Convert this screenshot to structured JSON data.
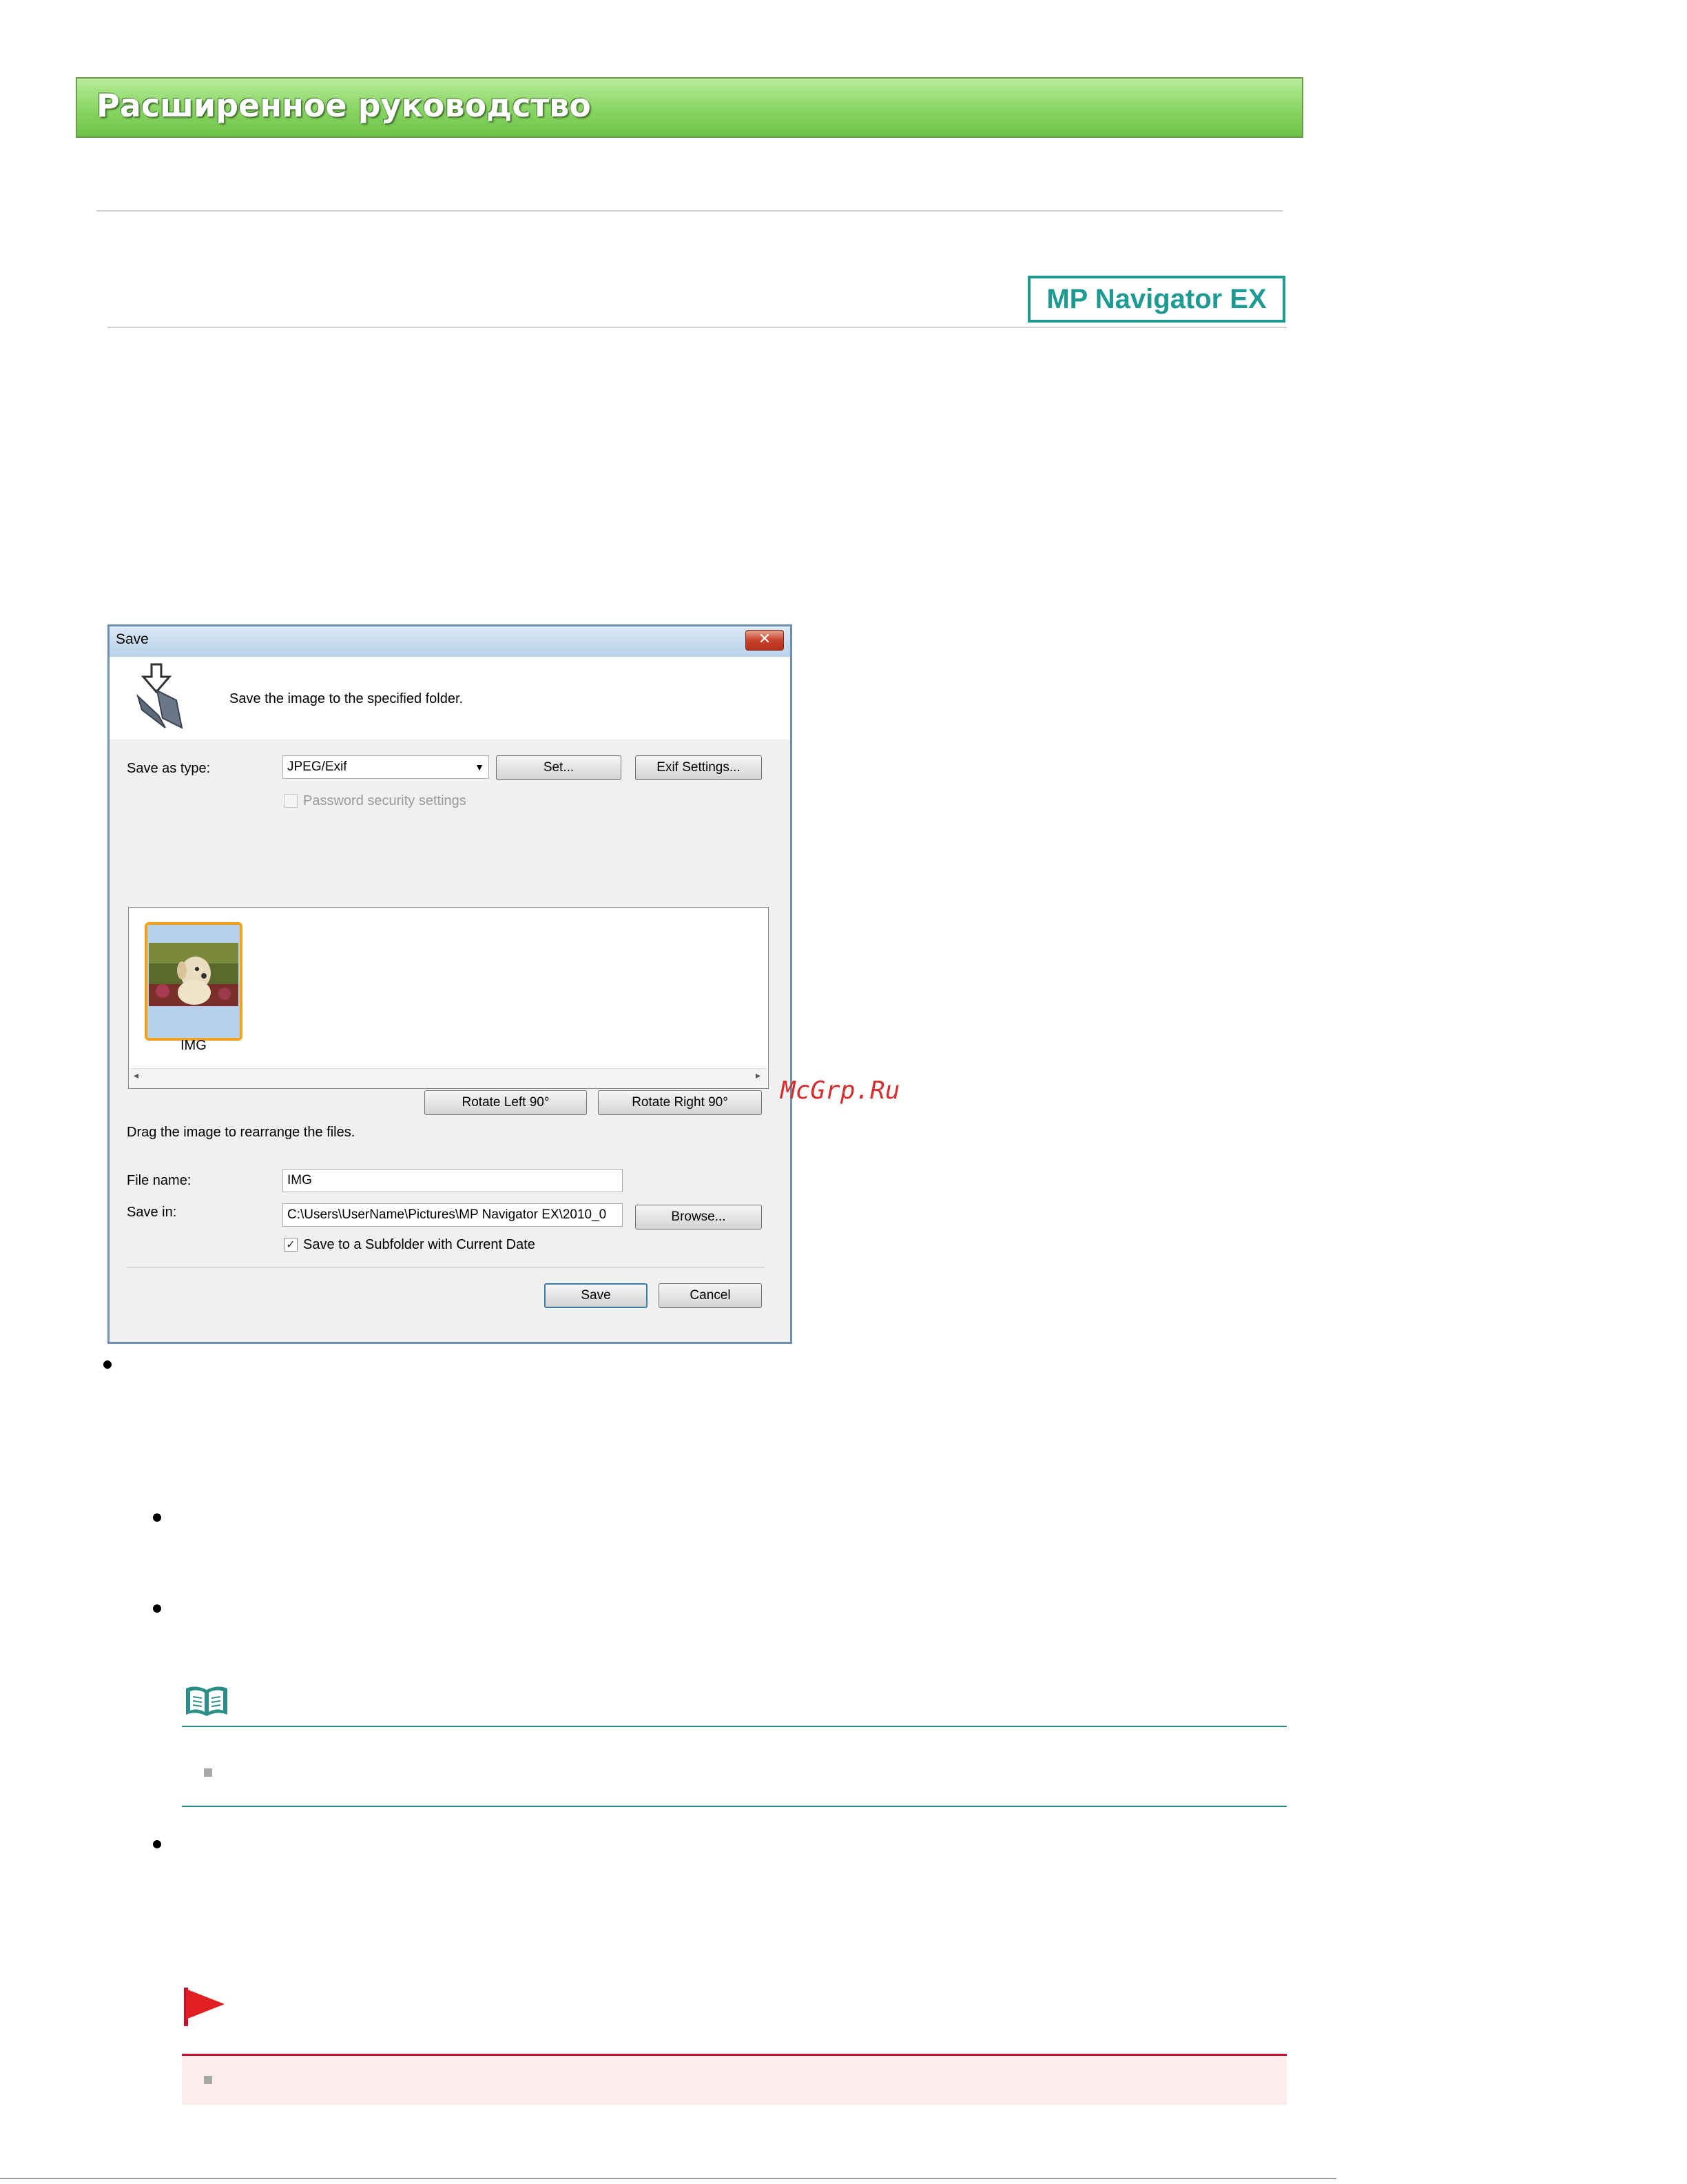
{
  "header": {
    "title": "Расширенное руководство"
  },
  "product_logo": {
    "text": "MP Navigator EX"
  },
  "dialog": {
    "title": "Save",
    "description": "Save the image to the specified folder.",
    "save_as_type_label": "Save as type:",
    "save_as_type_value": "JPEG/Exif",
    "set_button": "Set...",
    "exif_settings_button": "Exif Settings...",
    "password_label": "Password security settings",
    "thumbnail_label": "IMG",
    "rotate_left_button": "Rotate Left 90°",
    "rotate_right_button": "Rotate Right 90°",
    "drag_hint": "Drag the image to rearrange the files.",
    "file_name_label": "File name:",
    "file_name_value": "IMG",
    "save_in_label": "Save in:",
    "save_in_value": "C:\\Users\\UserName\\Pictures\\MP Navigator EX\\2010_0",
    "browse_button": "Browse...",
    "subfolder_label": "Save to a Subfolder with Current Date",
    "subfolder_checked": true,
    "save_button": "Save",
    "cancel_button": "Cancel"
  },
  "watermark": {
    "text": "McGrp.Ru"
  },
  "colors": {
    "header_green": "#7ccf56",
    "logo_teal": "#1f9a92",
    "note_teal": "#2a8d88",
    "important_red": "#c8102e",
    "important_bg": "#fdecec"
  }
}
